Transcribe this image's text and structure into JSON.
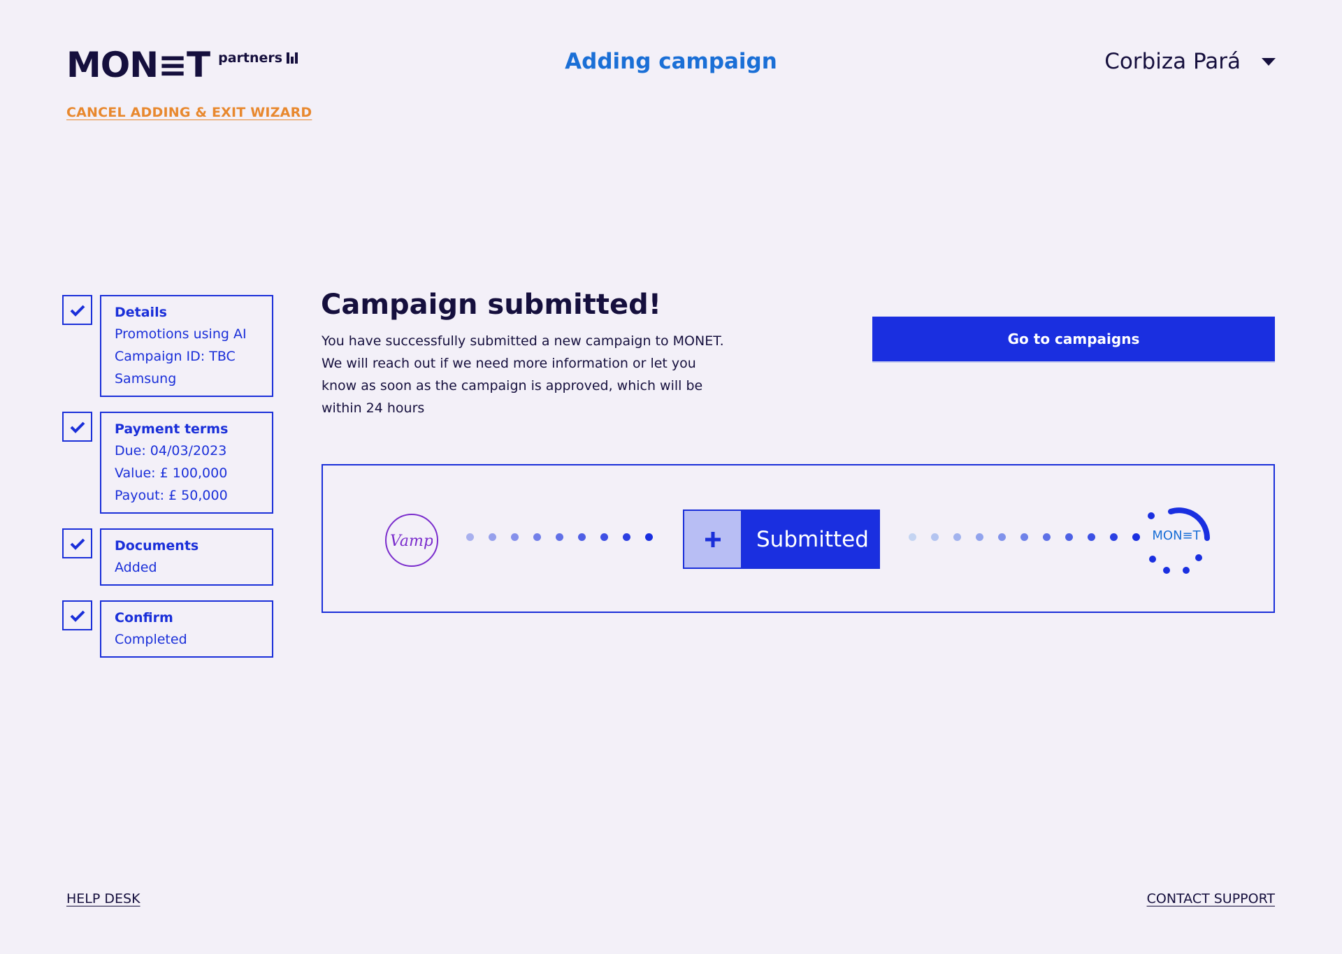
{
  "header": {
    "logo_main": "MON≡T",
    "logo_sub": "partners",
    "cancel_label": "CANCEL ADDING & EXIT WIZARD",
    "wizard_title": "Adding campaign",
    "user_name": "Corbiza Pará"
  },
  "steps": [
    {
      "title": "Details",
      "lines": [
        "Promotions using AI",
        "Campaign ID: TBC",
        "Samsung"
      ]
    },
    {
      "title": "Payment terms",
      "lines": [
        "Due: 04/03/2023",
        "Value: £ 100,000",
        "Payout: £ 50,000"
      ]
    },
    {
      "title": "Documents",
      "lines": [
        "Added"
      ]
    },
    {
      "title": "Confirm",
      "lines": [
        "Completed"
      ]
    }
  ],
  "main": {
    "heading": "Campaign submitted!",
    "description": "You have successfully submitted a new campaign to MONET. We will reach out if we need more information or let you know as soon as the campaign is approved, which will be within 24 hours",
    "go_button": "Go to campaigns"
  },
  "status": {
    "source_logo": "Vamp",
    "chip_label": "Submitted",
    "target_logo": "MON≡T"
  },
  "footer": {
    "help": "HELP DESK",
    "contact": "CONTACT SUPPORT"
  },
  "colors": {
    "accent": "#1a2fe0",
    "cancel": "#e8882e",
    "title": "#1a6fd6",
    "background": "#f3f0f8"
  }
}
